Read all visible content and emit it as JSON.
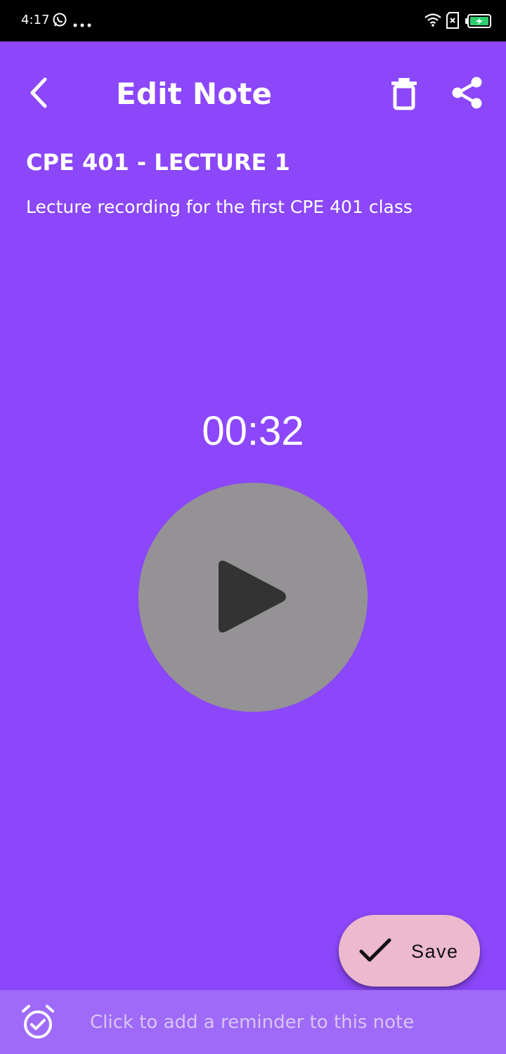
{
  "status_bar": {
    "time": "4:17",
    "icons": [
      "whatsapp-icon",
      "more-dots-icon",
      "wifi-icon",
      "sim-icon",
      "battery-charging-icon"
    ]
  },
  "toolbar": {
    "title": "Edit Note",
    "back_icon": "chevron-left-icon",
    "delete_icon": "trash-icon",
    "share_icon": "share-icon"
  },
  "note": {
    "title": "CPE 401 - LECTURE 1",
    "description": "Lecture recording for the first CPE 401 class"
  },
  "player": {
    "elapsed": "00:32",
    "play_icon": "play-icon"
  },
  "save_button": {
    "label": "Save",
    "icon": "check-icon"
  },
  "reminder": {
    "text": "Click to add a reminder to this note",
    "icon": "alarm-check-icon"
  },
  "colors": {
    "background": "#8b47f9",
    "status_bar": "#000000",
    "player_circle": "#959295",
    "play_glyph": "#333333",
    "save_fab": "#edb9ce",
    "reminder_bar": "#9f6af8",
    "reminder_text": "#d8c6f5"
  }
}
